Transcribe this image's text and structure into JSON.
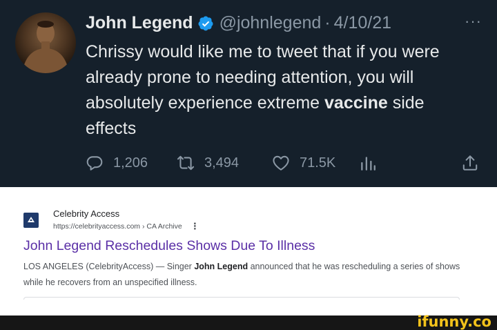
{
  "tweet": {
    "author_name": "John Legend",
    "handle": "@johnlegend",
    "separator": "·",
    "date": "4/10/21",
    "more": "···",
    "text_before": "Chrissy would like me to tweet that if you were already prone to needing attention, you will absolutely experience extreme ",
    "text_bold": "vaccine",
    "text_after": " side effects",
    "replies": "1,206",
    "retweets": "3,494",
    "likes": "71.5K",
    "icons": {
      "avatar": "avatar",
      "verified": "verified-badge-icon",
      "reply": "reply-icon",
      "retweet": "retweet-icon",
      "like": "heart-icon",
      "views": "views-chart-icon",
      "share": "share-icon"
    },
    "colors": {
      "background": "#15202b",
      "text": "#e7e9ea",
      "muted": "#8b98a5",
      "verified": "#1d9bf0"
    }
  },
  "search_result": {
    "site_name": "Celebrity Access",
    "url": "https://celebrityaccess.com › CA Archive",
    "menu": "⋮",
    "title": "John Legend Reschedules Shows Due To Illness",
    "snippet_before": "LOS ANGELES (CelebrityAccess) — Singer ",
    "snippet_bold": "John Legend",
    "snippet_after": " announced that he was rescheduling a series of shows while he recovers from an unspecified illness.",
    "colors": {
      "title": "#5a2fa6",
      "snippet": "#4d5156"
    }
  },
  "watermark": {
    "text": "ifunny.co",
    "color": "#f2c21b"
  }
}
